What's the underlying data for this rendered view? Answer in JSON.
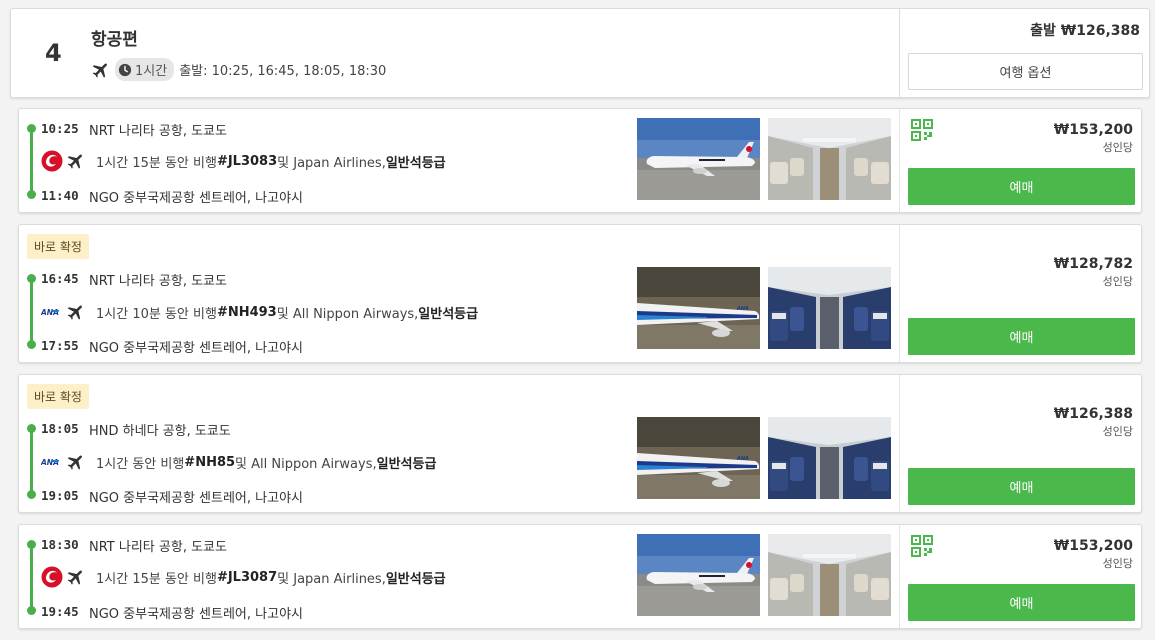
{
  "header": {
    "index": "4",
    "title": "항공편",
    "duration": "1시간",
    "departures": "출발: 10:25, 16:45, 18:05, 18:30",
    "from_price": "출발 ₩126,388",
    "options_label": "여행 옵션"
  },
  "colors": {
    "accent": "#4bb84b",
    "badge_bg": "#fdf0c9"
  },
  "flights": [
    {
      "badge": "",
      "dep_time": "10:25",
      "dep_place": "NRT 나리타 공항, 도쿄도",
      "arr_time": "11:40",
      "arr_place": "NGO 중부국제공항 센트레어, 나고야시",
      "dur_text": "1시간 15분 동안 비행 ",
      "flight_no": "#JL3083",
      "airline_text": " 및 Japan Airlines, ",
      "cabin": "일반석등급",
      "airline_logo": "jal-logo-icon",
      "price": "₩153,200",
      "per": "성인당",
      "book": "예매"
    },
    {
      "badge": "바로 확정",
      "dep_time": "16:45",
      "dep_place": "NRT 나리타 공항, 도쿄도",
      "arr_time": "17:55",
      "arr_place": "NGO 중부국제공항 센트레어, 나고야시",
      "dur_text": "1시간 10분 동안 비행 ",
      "flight_no": "#NH493",
      "airline_text": " 및 All Nippon Airways, ",
      "cabin": "일반석등급",
      "airline_logo": "ana-logo-icon",
      "price": "₩128,782",
      "per": "성인당",
      "book": "예매"
    },
    {
      "badge": "바로 확정",
      "dep_time": "18:05",
      "dep_place": "HND 하네다 공항, 도쿄도",
      "arr_time": "19:05",
      "arr_place": "NGO 중부국제공항 센트레어, 나고야시",
      "dur_text": "1시간 동안 비행 ",
      "flight_no": "#NH85",
      "airline_text": " 및 All Nippon Airways, ",
      "cabin": "일반석등급",
      "airline_logo": "ana-logo-icon",
      "price": "₩126,388",
      "per": "성인당",
      "book": "예매"
    },
    {
      "badge": "",
      "dep_time": "18:30",
      "dep_place": "NRT 나리타 공항, 도쿄도",
      "arr_time": "19:45",
      "arr_place": "NGO 중부국제공항 센트레어, 나고야시",
      "dur_text": "1시간 15분 동안 비행 ",
      "flight_no": "#JL3087",
      "airline_text": " 및 Japan Airlines, ",
      "cabin": "일반석등급",
      "airline_logo": "jal-logo-icon",
      "price": "₩153,200",
      "per": "성인당",
      "book": "예매"
    }
  ]
}
